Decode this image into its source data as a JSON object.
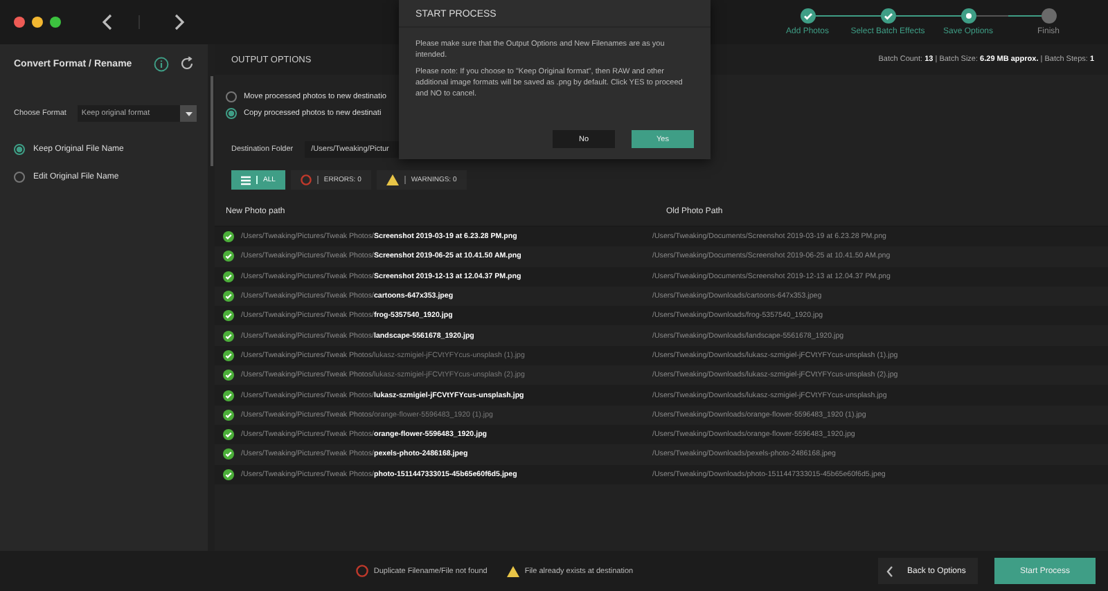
{
  "sidebar": {
    "title": "Convert Format / Rename",
    "format_label": "Choose Format",
    "format_value": "Keep original format",
    "name_options": [
      {
        "label": "Keep Original File Name",
        "selected": true
      },
      {
        "label": "Edit Original File Name",
        "selected": false
      }
    ]
  },
  "steps": [
    {
      "label": "Add Photos",
      "completed": true
    },
    {
      "label": "Select Batch Effects",
      "completed": true
    },
    {
      "label": "Save Options",
      "completed": false
    },
    {
      "label": "Finish",
      "completed": false
    }
  ],
  "output": {
    "title": "OUTPUT OPTIONS",
    "batch_info": "Batch Count: **13** | Batch Size: **6.29 MB approx.** | Batch Steps: **1**",
    "options": [
      {
        "label": "Move processed photos to new destinatio",
        "selected": false
      },
      {
        "label": "Copy processed photos to new destinati",
        "selected": true
      }
    ],
    "destination_label": "Destination Folder",
    "destination_value": "/Users/Tweaking/Pictur"
  },
  "filters": [
    {
      "kind": "all",
      "label": "ALL",
      "selected": true
    },
    {
      "kind": "errors",
      "label": "ERRORS: 0",
      "selected": false
    },
    {
      "kind": "warnings",
      "label": "WARNINGS: 0",
      "selected": false
    }
  ],
  "table": {
    "columns": [
      "New Photo path",
      "Old Photo Path"
    ],
    "rows": [
      {
        "dir": "/Users/Tweaking/Pictures/Tweak Photos/",
        "file": "Screenshot 2019-03-19 at 6.23.28 PM.png",
        "highlighted": true,
        "old": "/Users/Tweaking/Documents/Screenshot 2019-03-19 at 6.23.28 PM.png"
      },
      {
        "dir": "/Users/Tweaking/Pictures/Tweak Photos/",
        "file": "Screenshot 2019-06-25 at 10.41.50 AM.png",
        "highlighted": true,
        "old": "/Users/Tweaking/Documents/Screenshot 2019-06-25 at 10.41.50 AM.png"
      },
      {
        "dir": "/Users/Tweaking/Pictures/Tweak Photos/",
        "file": "Screenshot 2019-12-13 at 12.04.37 PM.png",
        "highlighted": true,
        "old": "/Users/Tweaking/Documents/Screenshot 2019-12-13 at 12.04.37 PM.png"
      },
      {
        "dir": "/Users/Tweaking/Pictures/Tweak Photos/",
        "file": "cartoons-647x353.jpeg",
        "highlighted": true,
        "old": "/Users/Tweaking/Downloads/cartoons-647x353.jpeg"
      },
      {
        "dir": "/Users/Tweaking/Pictures/Tweak Photos/",
        "file": "frog-5357540_1920.jpg",
        "highlighted": true,
        "old": "/Users/Tweaking/Downloads/frog-5357540_1920.jpg"
      },
      {
        "dir": "/Users/Tweaking/Pictures/Tweak Photos/",
        "file": "landscape-5561678_1920.jpg",
        "highlighted": true,
        "old": "/Users/Tweaking/Downloads/landscape-5561678_1920.jpg"
      },
      {
        "dir": "/Users/Tweaking/Pictures/Tweak Photos/",
        "file": "lukasz-szmigiel-jFCVtYFYcus-unsplash (1).jpg",
        "highlighted": false,
        "old": "/Users/Tweaking/Downloads/lukasz-szmigiel-jFCVtYFYcus-unsplash (1).jpg"
      },
      {
        "dir": "/Users/Tweaking/Pictures/Tweak Photos/",
        "file": "lukasz-szmigiel-jFCVtYFYcus-unsplash (2).jpg",
        "highlighted": false,
        "old": "/Users/Tweaking/Downloads/lukasz-szmigiel-jFCVtYFYcus-unsplash (2).jpg"
      },
      {
        "dir": "/Users/Tweaking/Pictures/Tweak Photos/",
        "file": "lukasz-szmigiel-jFCVtYFYcus-unsplash.jpg",
        "highlighted": true,
        "old": "/Users/Tweaking/Downloads/lukasz-szmigiel-jFCVtYFYcus-unsplash.jpg"
      },
      {
        "dir": "/Users/Tweaking/Pictures/Tweak Photos/",
        "file": "orange-flower-5596483_1920 (1).jpg",
        "highlighted": false,
        "old": "/Users/Tweaking/Downloads/orange-flower-5596483_1920 (1).jpg"
      },
      {
        "dir": "/Users/Tweaking/Pictures/Tweak Photos/",
        "file": "orange-flower-5596483_1920.jpg",
        "highlighted": true,
        "old": "/Users/Tweaking/Downloads/orange-flower-5596483_1920.jpg"
      },
      {
        "dir": "/Users/Tweaking/Pictures/Tweak Photos/",
        "file": "pexels-photo-2486168.jpeg",
        "highlighted": true,
        "old": "/Users/Tweaking/Downloads/pexels-photo-2486168.jpeg"
      },
      {
        "dir": "/Users/Tweaking/Pictures/Tweak Photos/",
        "file": "photo-1511447333015-45b65e60f6d5.jpeg",
        "highlighted": true,
        "old": "/Users/Tweaking/Downloads/photo-1511447333015-45b65e60f6d5.jpeg"
      }
    ]
  },
  "legend": [
    {
      "kind": "error",
      "label": "Duplicate Filename/File not found"
    },
    {
      "kind": "warning",
      "label": "File already exists at destination"
    }
  ],
  "footer_buttons": [
    {
      "kind": "back",
      "label": "Back to Options"
    },
    {
      "kind": "start",
      "label": "Start Process"
    }
  ],
  "dialog": {
    "title": "START PROCESS",
    "paragraphs": [
      "Please make sure that the Output Options and New Filenames are as you intended.",
      "Please note: If you choose to \"Keep Original format\", then RAW and other additional image formats will be saved as .png by default. Click YES to proceed and NO to cancel."
    ],
    "buttons": [
      {
        "kind": "no",
        "label": "No"
      },
      {
        "kind": "yes",
        "label": "Yes"
      }
    ]
  }
}
